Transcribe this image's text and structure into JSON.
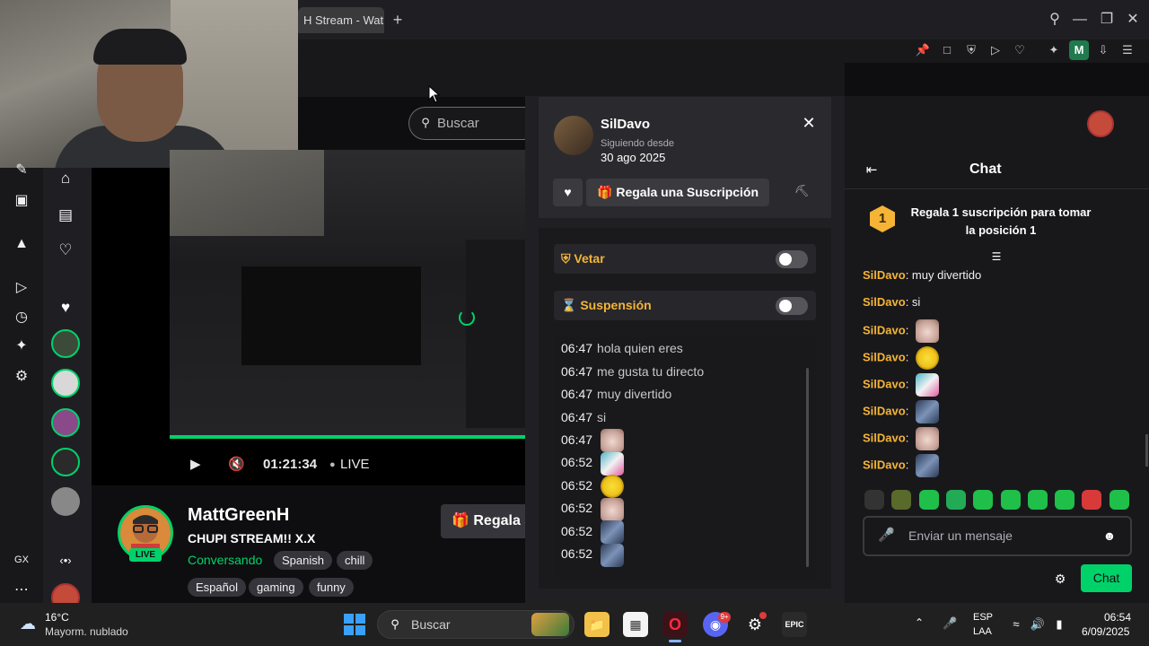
{
  "browser": {
    "tab_title": "H Stream - Wat",
    "new_tab": "+",
    "profile_initial": "M"
  },
  "search": {
    "placeholder": "Buscar"
  },
  "player": {
    "time": "01:21:34",
    "live_label": "LIVE"
  },
  "stream": {
    "streamer": "MattGreenH",
    "title": "CHUPI STREAM!! X.X",
    "category": "Conversando",
    "live_badge": "LIVE",
    "tags": [
      "Spanish",
      "chill",
      "Español",
      "gaming",
      "funny"
    ],
    "gift_button": "Regala S"
  },
  "usercard": {
    "username": "SilDavo",
    "following_since_label": "Siguiendo desde",
    "following_since_date": "30 ago 2025",
    "gift_sub_label": "Regala una Suscripción",
    "ban_label": "Vetar",
    "timeout_label": "Suspensión",
    "messages": [
      {
        "time": "06:47",
        "text": "hola quien eres",
        "emote": ""
      },
      {
        "time": "06:47",
        "text": "me gusta tu directo",
        "emote": ""
      },
      {
        "time": "06:47",
        "text": "muy divertido",
        "emote": ""
      },
      {
        "time": "06:47",
        "text": "si",
        "emote": ""
      },
      {
        "time": "06:47",
        "text": "",
        "emote": "cat"
      },
      {
        "time": "06:52",
        "text": "",
        "emote": "pen"
      },
      {
        "time": "06:52",
        "text": "",
        "emote": "bee"
      },
      {
        "time": "06:52",
        "text": "",
        "emote": "cat"
      },
      {
        "time": "06:52",
        "text": "",
        "emote": "fish"
      },
      {
        "time": "06:52",
        "text": "",
        "emote": "fish"
      }
    ]
  },
  "chat": {
    "title": "Chat",
    "gift_banner_rank": "1",
    "gift_banner_text": "Regala 1 suscripción para tomar la posición 1",
    "lines": [
      {
        "user": "SilDavo",
        "text": "muy divertido",
        "emote": ""
      },
      {
        "user": "SilDavo",
        "text": "si",
        "emote": ""
      },
      {
        "user": "SilDavo",
        "text": "",
        "emote": "cat"
      },
      {
        "user": "SilDavo",
        "text": "",
        "emote": "bee"
      },
      {
        "user": "SilDavo",
        "text": "",
        "emote": "pen"
      },
      {
        "user": "SilDavo",
        "text": "",
        "emote": "fish"
      },
      {
        "user": "SilDavo",
        "text": "",
        "emote": "cat"
      },
      {
        "user": "SilDavo",
        "text": "",
        "emote": "fish"
      }
    ],
    "input_placeholder": "Enviar un mensaje",
    "send_label": "Chat"
  },
  "leftnav": {
    "gx_label": "GX"
  },
  "taskbar": {
    "weather_temp": "16°C",
    "weather_desc": "Mayorm. nublado",
    "search_text": "Buscar",
    "lang_top": "ESP",
    "lang_bottom": "LAA",
    "time": "06:54",
    "date": "6/09/2025",
    "discord_badge": "9+"
  },
  "colors": {
    "accent_green": "#00d26a",
    "username_gold": "#f5b436",
    "background": "#0e0e10"
  }
}
